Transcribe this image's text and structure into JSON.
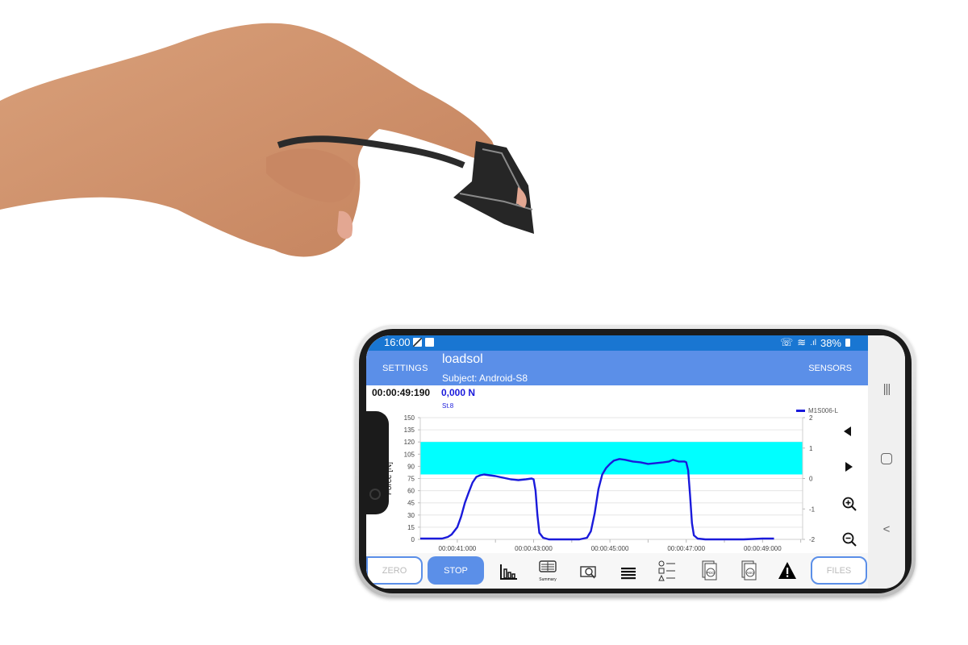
{
  "scene": {
    "photo_subject": "hand wearing finger-mounted force sensor with cable",
    "device": "smartphone in landscape orientation"
  },
  "statusbar": {
    "time": "16:00",
    "battery": "38%",
    "left_icons": [
      "edit-app-icon",
      "gallery-icon"
    ],
    "right_icons": [
      "wifi-call-icon",
      "wifi-icon",
      "signal-icon",
      "battery-icon"
    ]
  },
  "appbar": {
    "settings_label": "SETTINGS",
    "title": "loadsol",
    "subtitle": "Subject: Android-S8",
    "sensors_label": "SENSORS",
    "color": "#5b8fe8",
    "status_color": "#1976d2"
  },
  "readout": {
    "elapsed": "00:00:49:190",
    "force": "0,000 N",
    "step": "St.8"
  },
  "side_controls": [
    {
      "name": "pan-left-button",
      "icon": "triangle-left-icon"
    },
    {
      "name": "pan-right-button",
      "icon": "triangle-right-icon"
    },
    {
      "name": "zoom-in-button",
      "icon": "zoom-in-icon"
    },
    {
      "name": "zoom-out-button",
      "icon": "zoom-out-icon"
    }
  ],
  "bottombar": {
    "zero_label": "ZERO",
    "stop_label": "STOP",
    "files_label": "FILES",
    "tools": [
      {
        "name": "bar-chart-tool",
        "icon": "bar-chart-icon"
      },
      {
        "name": "summary-tool",
        "icon": "summary-icon",
        "label": "Summary"
      },
      {
        "name": "inspect-tool",
        "icon": "inspect-icon"
      },
      {
        "name": "menu-tool",
        "icon": "stack-lines-icon"
      },
      {
        "name": "shapes-list-tool",
        "icon": "shapes-list-icon"
      },
      {
        "name": "pdo-file-tool",
        "icon": "pdo-file-icon",
        "label": "PDO"
      },
      {
        "name": "aso-file-tool",
        "icon": "aso-file-icon",
        "label": "ASO"
      },
      {
        "name": "warning-tool",
        "icon": "warning-icon"
      }
    ]
  },
  "navbar": {
    "recents": "|||",
    "home": "○",
    "back": "<"
  },
  "chart_data": {
    "type": "line",
    "title": "",
    "xlabel": "",
    "ylabel": "Force [N]",
    "ylim": [
      0,
      150
    ],
    "y_ticks": [
      0,
      15,
      30,
      45,
      60,
      75,
      90,
      105,
      120,
      135,
      150
    ],
    "y2lim": [
      -2,
      2
    ],
    "y2_ticks": [
      -2,
      -1,
      0,
      1,
      2
    ],
    "xlim_seconds": [
      40.03,
      50.05
    ],
    "x_ticks": [
      {
        "t": 41,
        "label": "00:00:41:000"
      },
      {
        "t": 43,
        "label": "00:00:43:000"
      },
      {
        "t": 45,
        "label": "00:00:45:000"
      },
      {
        "t": 47,
        "label": "00:00:47:000"
      },
      {
        "t": 49,
        "label": "00:00:49:000"
      }
    ],
    "x_minor_ticks": [
      42,
      44,
      46,
      48,
      50
    ],
    "grid": true,
    "target_band": {
      "from": 80,
      "to": 120,
      "color": "#00ffff"
    },
    "legend_position": "top-right",
    "series": [
      {
        "name": "M1S006-L",
        "color": "#1a1adb",
        "t": [
          40.03,
          40.3,
          40.6,
          40.75,
          40.85,
          41.0,
          41.1,
          41.2,
          41.3,
          41.4,
          41.5,
          41.6,
          41.7,
          41.85,
          42.0,
          42.2,
          42.4,
          42.6,
          42.8,
          42.95,
          43.0,
          43.05,
          43.1,
          43.15,
          43.25,
          43.4,
          43.8,
          44.2,
          44.4,
          44.5,
          44.6,
          44.7,
          44.8,
          44.9,
          45.0,
          45.1,
          45.25,
          45.4,
          45.6,
          45.8,
          46.0,
          46.2,
          46.4,
          46.55,
          46.65,
          46.8,
          46.95,
          47.0,
          47.05,
          47.1,
          47.15,
          47.2,
          47.3,
          47.5,
          48.0,
          48.5,
          49.0,
          49.3
        ],
        "values": [
          1,
          1,
          1,
          3,
          6,
          15,
          28,
          45,
          58,
          70,
          77,
          79,
          80,
          79,
          78,
          76,
          74,
          73,
          74,
          75,
          74,
          60,
          30,
          8,
          2,
          0,
          0,
          0,
          2,
          10,
          32,
          62,
          80,
          88,
          93,
          97,
          99,
          98,
          96,
          95,
          93,
          94,
          95,
          96,
          98,
          96,
          96,
          95,
          85,
          55,
          20,
          5,
          1,
          0,
          0,
          0,
          1,
          1
        ]
      }
    ]
  }
}
